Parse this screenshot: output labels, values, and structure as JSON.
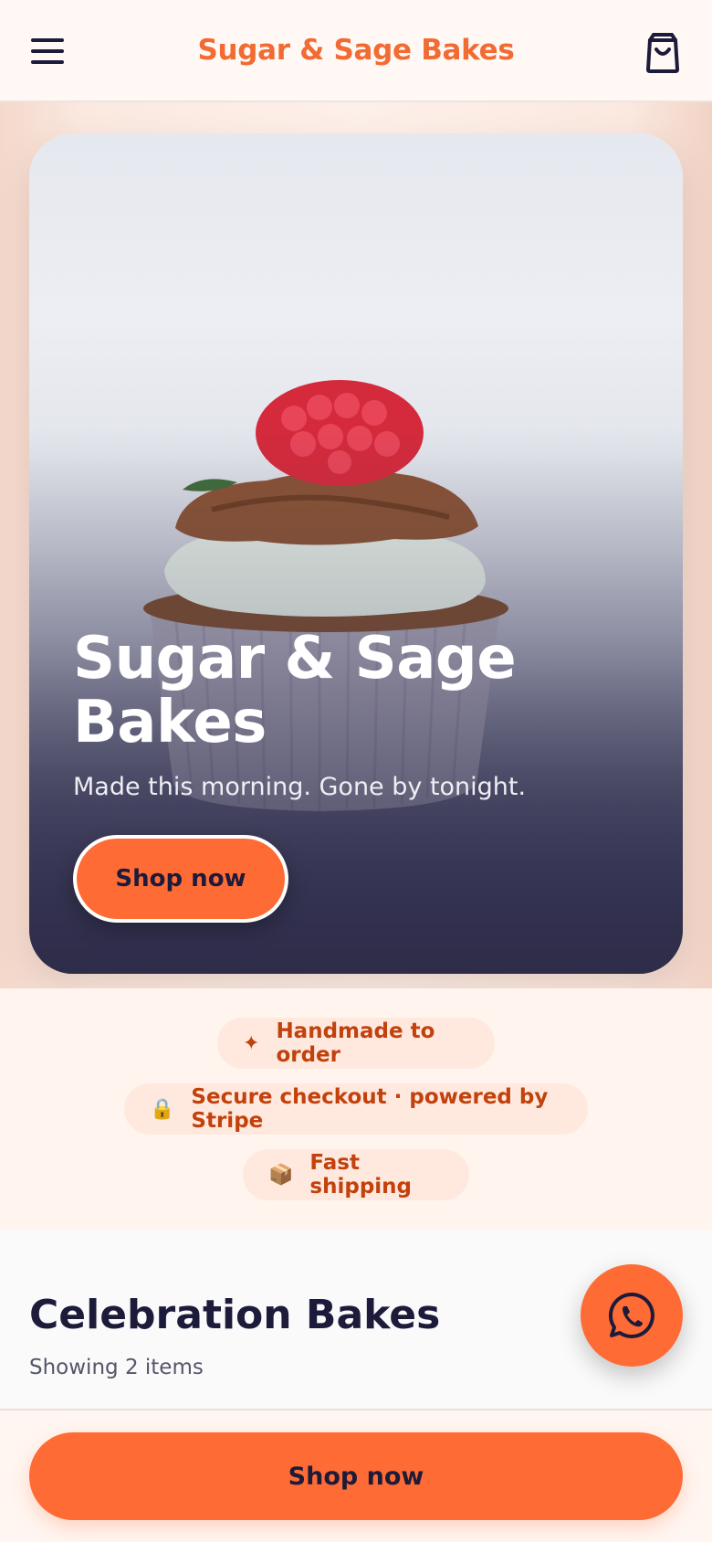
{
  "header": {
    "brand": "Sugar & Sage Bakes",
    "menu_icon": "hamburger-menu-icon",
    "cart_icon": "shopping-bag-icon"
  },
  "hero": {
    "title": "Sugar & Sage Bakes",
    "subtitle": "Made this morning. Gone by tonight.",
    "cta_label": "Shop now",
    "image": "cupcake-with-raspberry"
  },
  "badges": [
    {
      "icon": "sparkle-icon",
      "glyph": "✦",
      "label": "Handmade to order"
    },
    {
      "icon": "lock-icon",
      "glyph": "🔒",
      "label": "Secure checkout · powered by Stripe"
    },
    {
      "icon": "package-icon",
      "glyph": "📦",
      "label": "Fast shipping"
    }
  ],
  "section": {
    "title": "Celebration Bakes",
    "count_text": "Showing 2 items"
  },
  "floating": {
    "icon": "whatsapp-icon"
  },
  "bottom_bar": {
    "cta_label": "Shop now"
  },
  "colors": {
    "accent": "#ff6b35",
    "brand_text": "#f26b32",
    "badge_bg": "#ffe9df",
    "badge_text": "#c2410c",
    "ink": "#1d1b3a"
  }
}
